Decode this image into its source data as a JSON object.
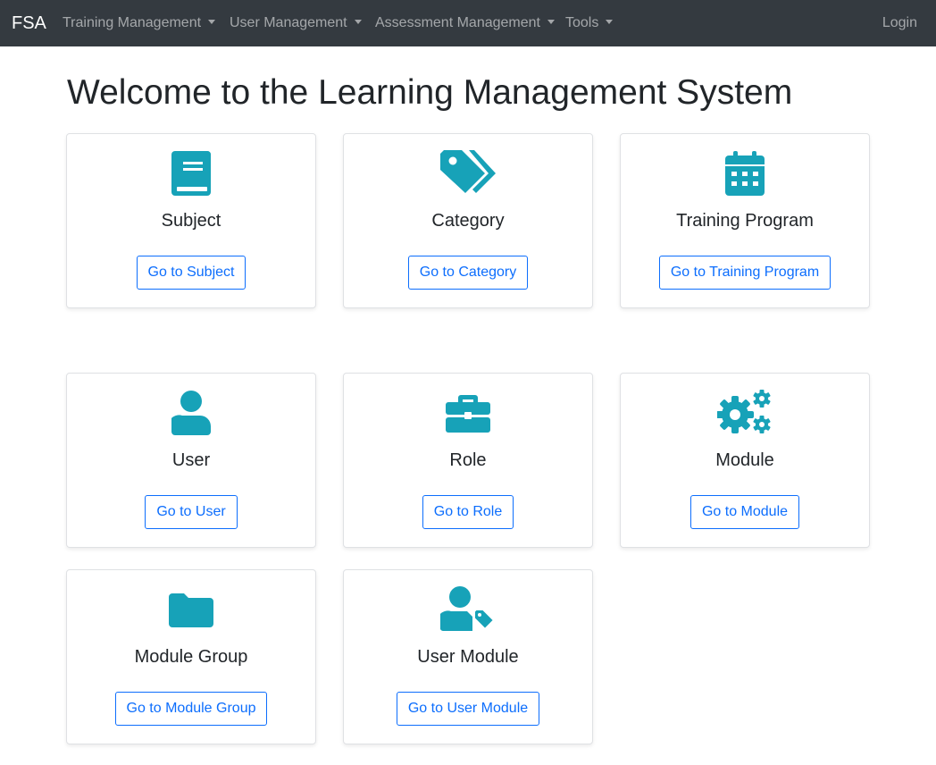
{
  "navbar": {
    "brand": "FSA",
    "menus": [
      {
        "label": "Training Management"
      },
      {
        "label": "User Management"
      },
      {
        "label": "Assessment Management"
      },
      {
        "label": "Tools"
      }
    ],
    "login_label": "Login"
  },
  "page": {
    "title": "Welcome to the Learning Management System"
  },
  "colors": {
    "navbar_bg": "#343a40",
    "icon_teal": "#17a2b8",
    "button_blue": "#0d6efd"
  },
  "cards": [
    {
      "title": "Subject",
      "button": "Go to Subject",
      "icon": "book-icon"
    },
    {
      "title": "Category",
      "button": "Go to Category",
      "icon": "tags-icon"
    },
    {
      "title": "Training Program",
      "button": "Go to Training Program",
      "icon": "calendar-icon"
    },
    {
      "title": "User",
      "button": "Go to User",
      "icon": "user-icon"
    },
    {
      "title": "Role",
      "button": "Go to Role",
      "icon": "briefcase-icon"
    },
    {
      "title": "Module",
      "button": "Go to Module",
      "icon": "cogs-icon"
    },
    {
      "title": "Module Group",
      "button": "Go to Module Group",
      "icon": "folder-icon"
    },
    {
      "title": "User Module",
      "button": "Go to User Module",
      "icon": "user-tag-icon"
    }
  ]
}
